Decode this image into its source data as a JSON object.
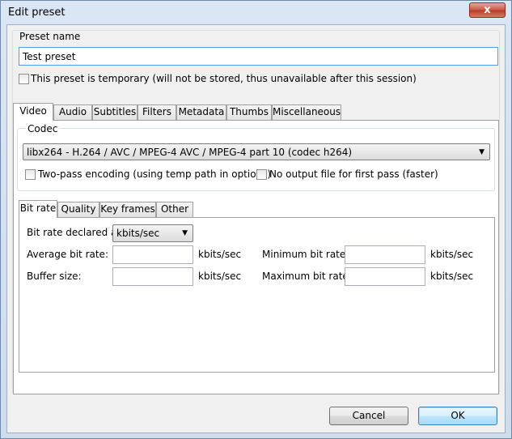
{
  "window": {
    "title": "Edit preset",
    "close_label": "x"
  },
  "preset": {
    "name_label": "Preset name",
    "name_value": "Test preset",
    "temporary_label": "This preset is temporary (will not be stored, thus unavailable after this session)"
  },
  "main_tabs": [
    "Video",
    "Audio",
    "Subtitles",
    "Filters",
    "Metadata",
    "Thumbs",
    "Miscellaneous"
  ],
  "codec": {
    "group_label": "Codec",
    "selected": "libx264 - H.264 / AVC / MPEG-4 AVC / MPEG-4 part 10 (codec h264)",
    "two_pass_label": "Two-pass encoding (using temp path in options)",
    "no_output_label": "No output file for first pass (faster)"
  },
  "sub_tabs": [
    "Bit rate",
    "Quality",
    "Key frames",
    "Other"
  ],
  "bitrate": {
    "declared_label": "Bit rate declared as:",
    "declared_value": "kbits/sec",
    "average_label": "Average bit rate:",
    "minimum_label": "Minimum bit rate:",
    "buffer_label": "Buffer size:",
    "maximum_label": "Maximum bit rate:",
    "unit": "kbits/sec"
  },
  "buttons": {
    "cancel": "Cancel",
    "ok": "OK"
  }
}
